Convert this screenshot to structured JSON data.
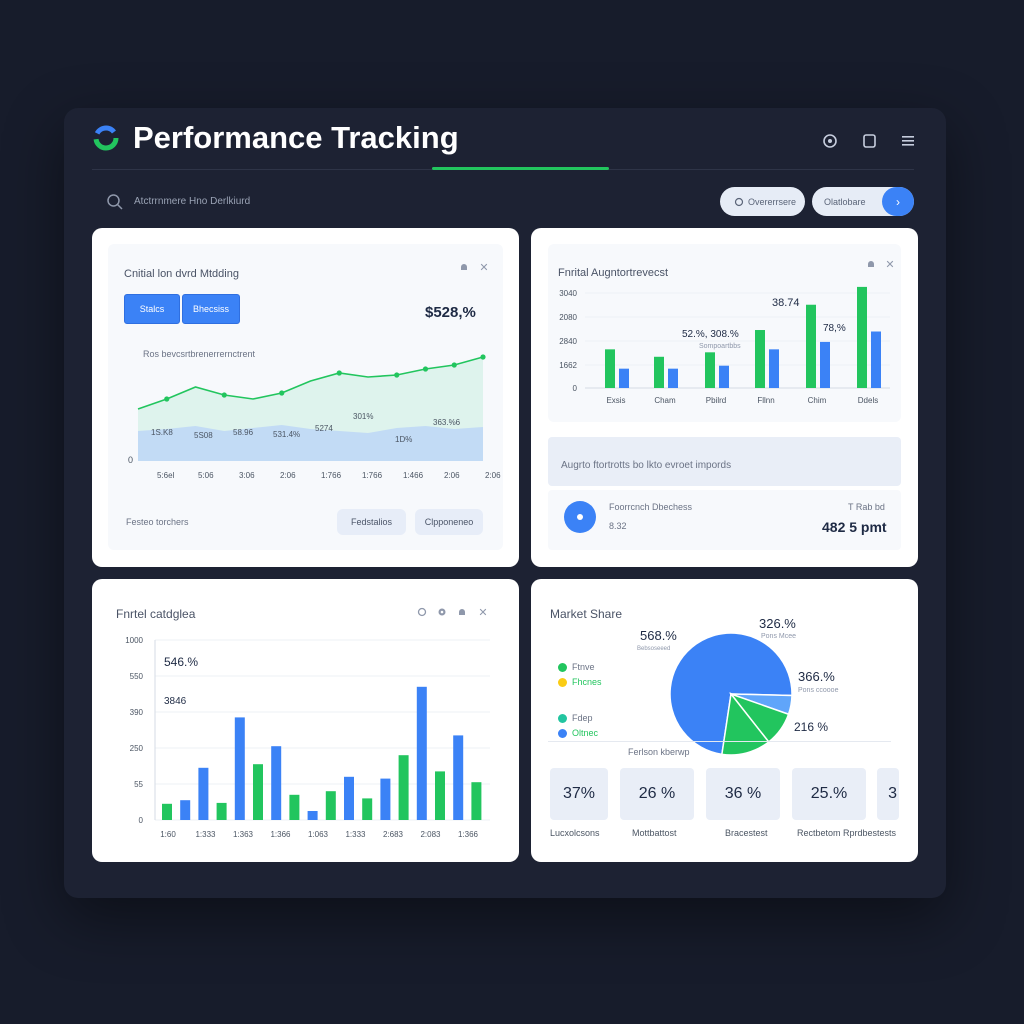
{
  "header": {
    "title": "Performance Tracking",
    "search_text": "Atctrrnmere Hno Derlkiurd",
    "pills": [
      "Overerrsere",
      "Olatlobare"
    ]
  },
  "colors": {
    "accent_green": "#22c55e",
    "accent_blue": "#3b82f6",
    "background": "#171c2b",
    "panel": "#1d2233",
    "card": "#ffffff"
  },
  "card1": {
    "title": "Cnitial lon dvrd Mtdding",
    "buttons": [
      "Stalcs",
      "Bhecsiss"
    ],
    "value": "$528,%",
    "subtitle": "Ros bevcsrtbrenerrernctrent",
    "footer_text": "Festeo torchers",
    "footer_buttons": [
      "Fedstalios",
      "Clpponeneo"
    ]
  },
  "card2": {
    "title": "Fnrital Augntortrevecst",
    "annotations": [
      "38.74",
      "52.%, 308.%",
      "Sompoartbbs",
      "78,%"
    ],
    "section_title": "Augrto ftortrotts bo lkto evroet impords",
    "item_label": "Foorrcnch Dbechess",
    "item_value": "8.32",
    "item_right_label": "T Rab bd",
    "item_right_value": "482 5 pmt"
  },
  "card3": {
    "title": "Fnrtel catdglea",
    "annotations": [
      "546.%",
      "3846"
    ]
  },
  "card4": {
    "title": "Market Share",
    "slice_labels": [
      "568.%",
      "326.%",
      "366.%",
      "216 %"
    ],
    "slice_sublabels": [
      "Bebsoseeed",
      "Pons Mcee",
      "Pons ccoooe"
    ],
    "legend": [
      {
        "label": "Ftnve",
        "color": "#22c55e"
      },
      {
        "label": "Fhcnes",
        "color": "#facc15"
      },
      {
        "label": "Fdep",
        "color": "#22c5a0"
      },
      {
        "label": "Oltnec",
        "color": "#3b82f6"
      }
    ],
    "pie_caption": "Ferlson kberwp",
    "stats": [
      {
        "value": "37%",
        "label": "Lucxolcsons"
      },
      {
        "value": "26 %",
        "label": "Mottbattost"
      },
      {
        "value": "36 %",
        "label": "Bracestest"
      },
      {
        "value": "25.%",
        "label": "Rectbetom Rprdbestests"
      }
    ],
    "stat_partial": "3"
  },
  "chart_data": [
    {
      "type": "area",
      "x": [
        "5:6el",
        "5:06",
        "3:06",
        "2:06",
        "1:766",
        "1:766",
        "1:466",
        "2:06",
        "2:06"
      ],
      "y_axis_ticks": [
        "0"
      ],
      "series": [
        {
          "values": [
            52,
            62,
            74,
            66,
            62,
            68,
            80,
            88,
            84,
            86,
            92,
            96,
            104
          ]
        },
        {
          "values": [
            30,
            32,
            35,
            30,
            33,
            36,
            32,
            30,
            28,
            33,
            35,
            32,
            34
          ]
        }
      ],
      "data_labels": [
        "1S.K8",
        "5S08",
        "58.96",
        "531.4%",
        "5274",
        "301%",
        "1D%",
        "363.%6"
      ],
      "ylim": [
        0,
        130
      ]
    },
    {
      "type": "bar",
      "categories": [
        "Exsis",
        "Cham",
        "Pbilrd",
        "Fllnn",
        "Chim",
        "Ddels"
      ],
      "series": [
        {
          "color": "#22c55e",
          "values": [
            1300,
            1050,
            1200,
            1950,
            2800,
            3400
          ]
        },
        {
          "color": "#3b82f6",
          "values": [
            650,
            650,
            750,
            1300,
            1550,
            1900
          ]
        }
      ],
      "y_ticks": [
        "0",
        "1662",
        "2840",
        "2080",
        "3040"
      ],
      "ylim": [
        0,
        3800
      ]
    },
    {
      "type": "bar",
      "x_ticks": [
        "1:60",
        "1:333",
        "1:363",
        "1:366",
        "1:063",
        "1:333",
        "2:683",
        "2:083",
        "1:366"
      ],
      "series_colors": [
        "#22c55e",
        "#3b82f6"
      ],
      "values": [
        [
          1,
          90,
          "#22c55e"
        ],
        [
          2,
          110,
          "#3b82f6"
        ],
        [
          3,
          290,
          "#3b82f6"
        ],
        [
          4,
          95,
          "#22c55e"
        ],
        [
          5,
          570,
          "#3b82f6"
        ],
        [
          6,
          310,
          "#22c55e"
        ],
        [
          7,
          410,
          "#3b82f6"
        ],
        [
          8,
          140,
          "#22c55e"
        ],
        [
          9,
          50,
          "#3b82f6"
        ],
        [
          10,
          160,
          "#22c55e"
        ],
        [
          11,
          240,
          "#3b82f6"
        ],
        [
          12,
          120,
          "#22c55e"
        ],
        [
          13,
          230,
          "#3b82f6"
        ],
        [
          14,
          360,
          "#22c55e"
        ],
        [
          15,
          740,
          "#3b82f6"
        ],
        [
          16,
          270,
          "#22c55e"
        ],
        [
          17,
          470,
          "#3b82f6"
        ],
        [
          18,
          210,
          "#22c55e"
        ]
      ],
      "y_ticks": [
        "0",
        "55",
        "250",
        "390",
        "550",
        "1000"
      ],
      "ylim": [
        0,
        1000
      ]
    },
    {
      "type": "pie",
      "slices": [
        {
          "value": 73,
          "color": "#3b82f6"
        },
        {
          "value": 5,
          "color": "#60a5fa"
        },
        {
          "value": 9,
          "color": "#22c55e"
        },
        {
          "value": 13,
          "color": "#22c55e"
        }
      ]
    }
  ]
}
